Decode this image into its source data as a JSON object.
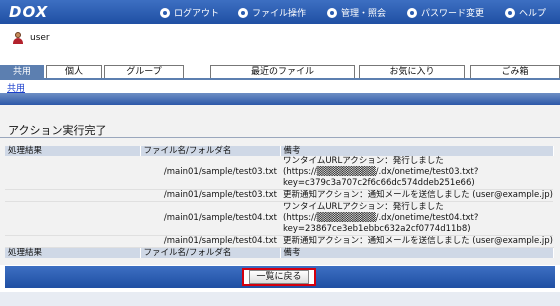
{
  "header": {
    "logo": "DOX",
    "nav": [
      {
        "label": "ログアウト",
        "icon": "logout-icon"
      },
      {
        "label": "ファイル操作",
        "icon": "file-ops-icon"
      },
      {
        "label": "管理・照会",
        "icon": "admin-icon"
      },
      {
        "label": "パスワード変更",
        "icon": "password-icon"
      },
      {
        "label": "ヘルプ",
        "icon": "help-icon"
      }
    ]
  },
  "user": {
    "name": "user",
    "icon": "user-icon"
  },
  "tabs": [
    {
      "label": "共用",
      "active": true
    },
    {
      "label": "個人"
    },
    {
      "label": "グループ"
    },
    {
      "label": "最近のファイル"
    },
    {
      "label": "お気に入り"
    },
    {
      "label": "ごみ箱"
    }
  ],
  "breadcrumb": "共用",
  "page_title": "アクション実行完了",
  "table": {
    "headers": [
      "処理結果",
      "ファイル名/フォルダ名",
      "備考"
    ],
    "rows": [
      {
        "path": "/main01/sample/test03.txt",
        "notes": [
          "ワンタイムURLアクション：発行しました",
          "(https://▒▒▒▒▒▒▒▒▒/.dx/onetime/test03.txt?",
          "key=c379c3a707c2f6c66dc574ddeb251e66)"
        ]
      },
      {
        "path": "/main01/sample/test03.txt",
        "notes": [
          "更新通知アクション：通知メールを送信しました (user@example.jp)"
        ]
      },
      {
        "path": "/main01/sample/test04.txt",
        "notes": [
          "ワンタイムURLアクション：発行しました",
          "(https://▒▒▒▒▒▒▒▒▒/.dx/onetime/test04.txt?",
          "key=23867ce3eb1ebbc632a2cf0774d11b8)"
        ]
      },
      {
        "path": "/main01/sample/test04.txt",
        "notes": [
          "更新通知アクション：通知メールを送信しました (user@example.jp)"
        ]
      }
    ]
  },
  "back_button": "一覧に戻る",
  "colors": {
    "header_blue": "#2a5cb0",
    "highlight_red": "#d4000f"
  }
}
